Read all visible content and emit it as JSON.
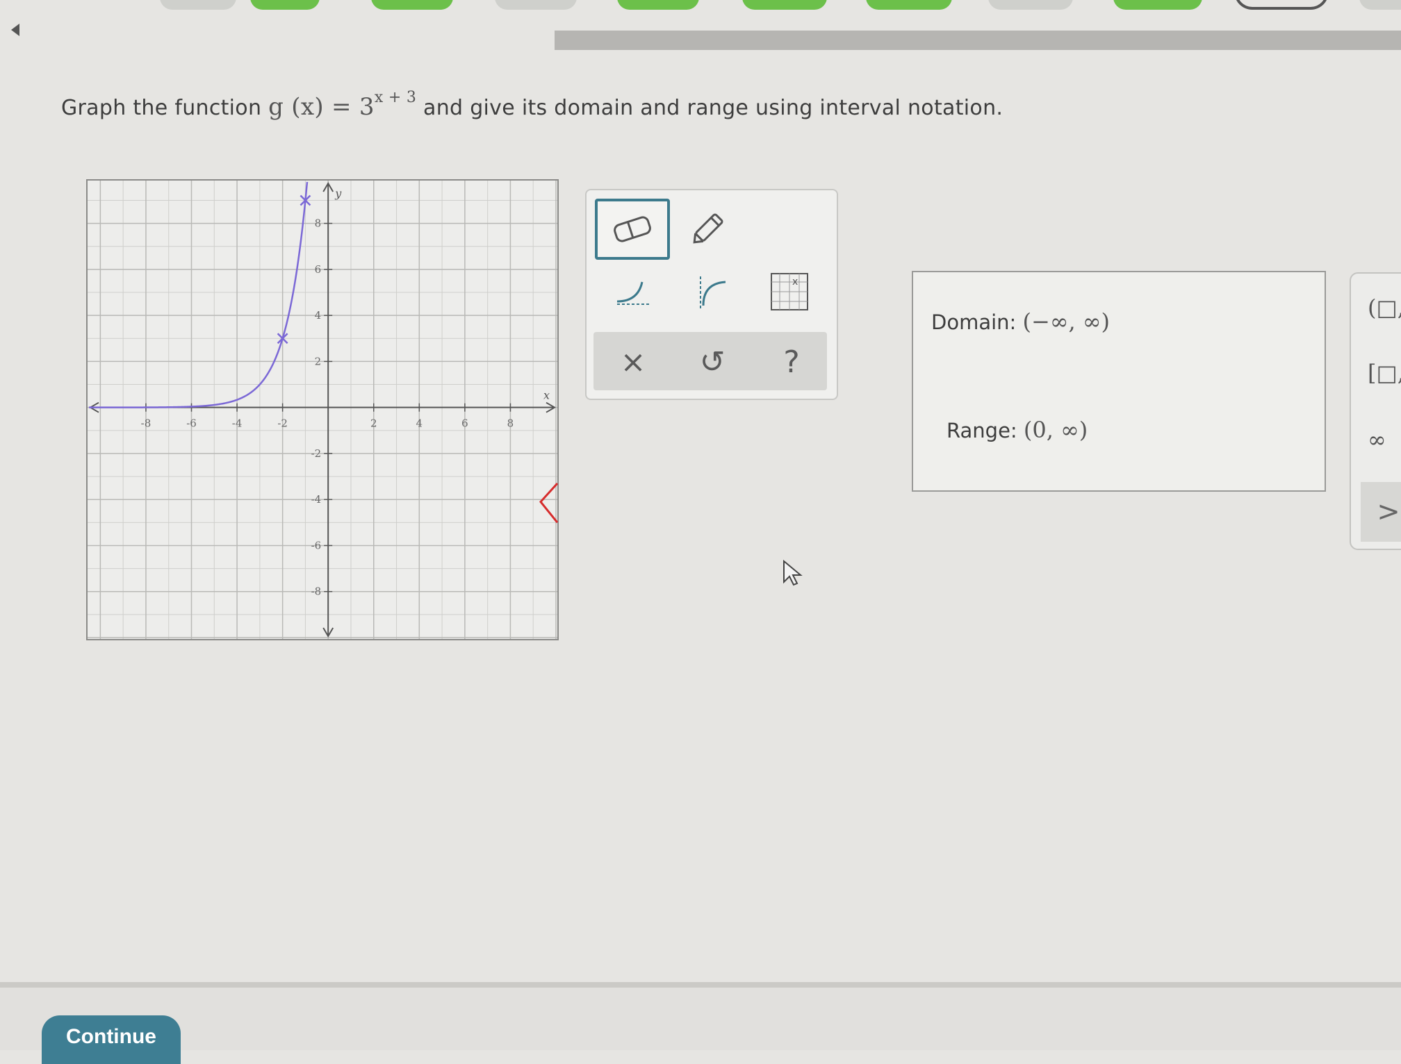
{
  "question": {
    "prefix": "Graph the function",
    "function_lhs": "g (x) = 3",
    "exponent": "x + 3",
    "suffix": "and give its domain and range using interval notation."
  },
  "graph": {
    "x_axis_label": "x",
    "y_axis_label": "y",
    "x_ticks": [
      "-8",
      "-6",
      "-4",
      "-2",
      "2",
      "4",
      "6",
      "8"
    ],
    "y_ticks": [
      "8",
      "6",
      "4",
      "2",
      "-2",
      "-4",
      "-6",
      "-8"
    ],
    "xlim": [
      -10.5,
      10
    ],
    "ylim": [
      -10,
      9.8
    ],
    "curve_color": "#7b68d6",
    "plotted_points": [
      {
        "x": -2,
        "y": 3
      },
      {
        "x": -1,
        "y": 9
      }
    ]
  },
  "tools": {
    "eraser": "eraser-icon",
    "pencil": "pencil-icon",
    "exp_decay": "exponential-curve-icon",
    "log_curve": "logarithmic-curve-icon",
    "grid_tool": "grid-icon",
    "clear_label": "×",
    "undo_label": "↺",
    "help_label": "?"
  },
  "answer": {
    "domain_label": "Domain:",
    "domain_value": "(−∞, ∞)",
    "range_label": "Range:",
    "range_value": "(0, ∞)"
  },
  "keypad": {
    "key_open_interval": "(□,□)",
    "key_closed_interval": "[□,□]",
    "key_infinity": "∞",
    "next_label": ">"
  },
  "footer": {
    "continue_label": "Continue"
  },
  "colors": {
    "accent": "#3e7e93",
    "progress_done": "#6cc04a",
    "curve": "#7b68d6",
    "warning": "#d62c2c"
  }
}
